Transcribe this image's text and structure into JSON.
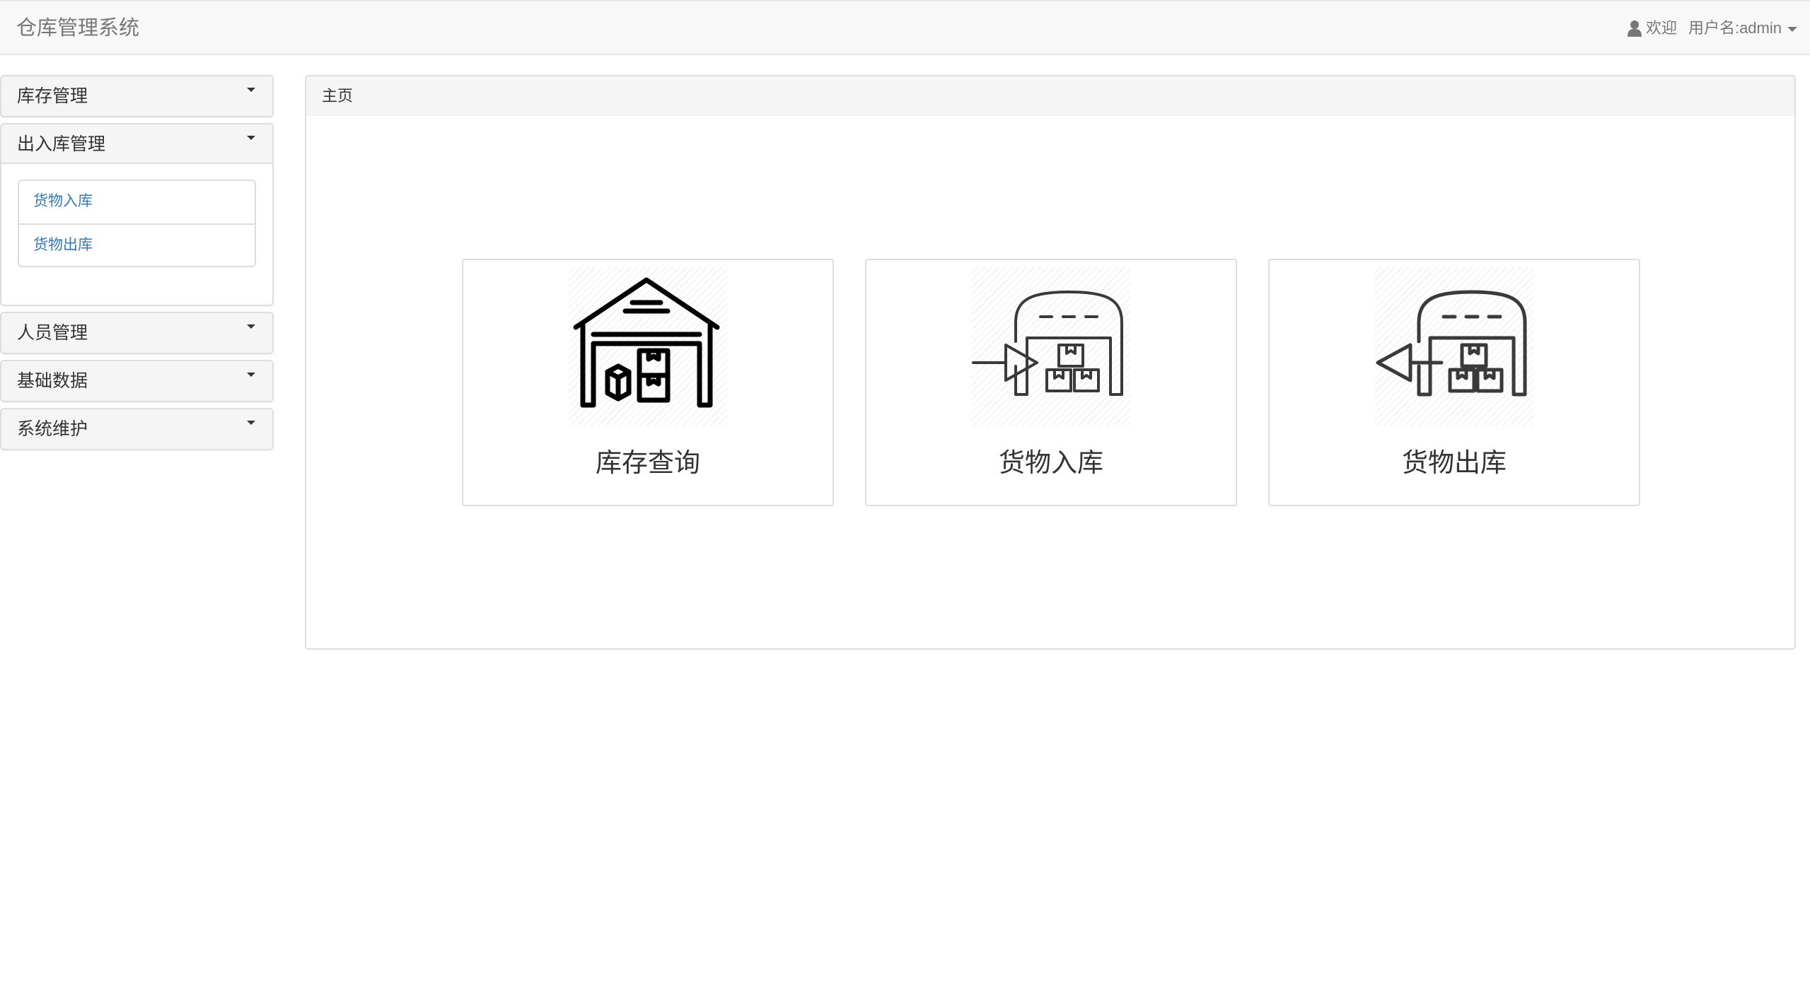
{
  "navbar": {
    "brand": "仓库管理系统",
    "welcome": "欢迎",
    "username": "用户名:admin"
  },
  "sidebar": {
    "panels": [
      {
        "title": "库存管理"
      },
      {
        "title": "出入库管理",
        "items": [
          {
            "label": "货物入库"
          },
          {
            "label": "货物出库"
          }
        ]
      },
      {
        "title": "人员管理"
      },
      {
        "title": "基础数据"
      },
      {
        "title": "系统维护"
      }
    ]
  },
  "main": {
    "heading": "主页",
    "cards": [
      {
        "label": "库存查询",
        "icon": "warehouse-icon"
      },
      {
        "label": "货物入库",
        "icon": "warehouse-inbound-icon"
      },
      {
        "label": "货物出库",
        "icon": "warehouse-outbound-icon"
      }
    ]
  },
  "colors": {
    "navbar_bg": "#f8f8f8",
    "link": "#337ab7",
    "panel_heading_bg": "#f5f5f5",
    "border": "#dddddd"
  }
}
